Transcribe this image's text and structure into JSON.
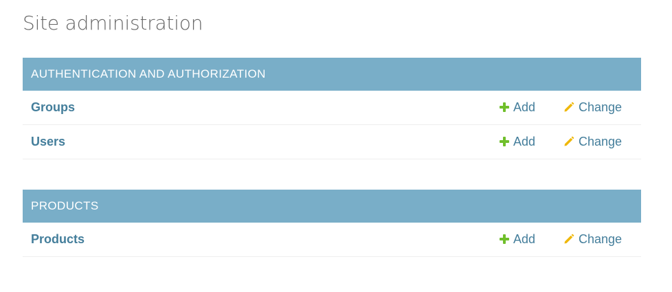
{
  "page_title": "Site administration",
  "colors": {
    "caption_bg": "#79aec8",
    "link": "#447e9b",
    "add_icon": "#70bf2b",
    "change_icon": "#efb80b"
  },
  "modules": [
    {
      "caption": "AUTHENTICATION AND AUTHORIZATION",
      "rows": [
        {
          "label": "Groups",
          "add": "Add",
          "change": "Change"
        },
        {
          "label": "Users",
          "add": "Add",
          "change": "Change"
        }
      ]
    },
    {
      "caption": "PRODUCTS",
      "rows": [
        {
          "label": "Products",
          "add": "Add",
          "change": "Change"
        }
      ]
    }
  ],
  "icons": {
    "add": "plus-icon",
    "change": "pencil-icon"
  }
}
